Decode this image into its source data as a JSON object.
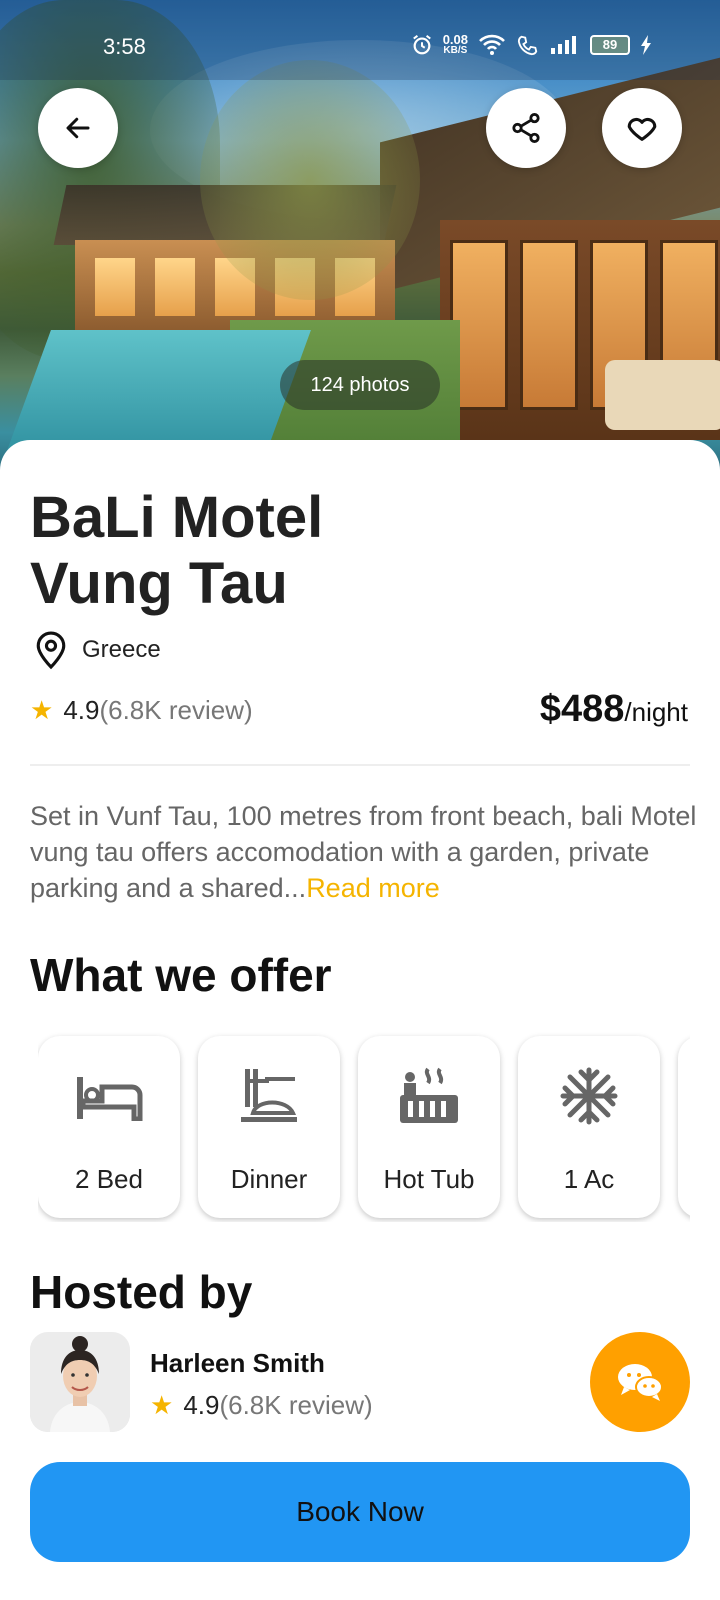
{
  "status_bar": {
    "time": "3:58",
    "speed_value": "0.08",
    "speed_unit": "KB/S",
    "battery": "89"
  },
  "hero": {
    "photos_label": "124 photos"
  },
  "listing": {
    "title_line1": "BaLi Motel",
    "title_line2": "Vung Tau",
    "location": "Greece",
    "rating": "4.9",
    "reviews": "(6.8K review)",
    "price": "$488",
    "price_unit": "/night",
    "description": "Set in Vunf Tau, 100 metres from front beach, bali Motel vung tau offers accomodation with a garden, private parking and a shared...",
    "read_more": "Read more"
  },
  "offers": {
    "heading": "What we offer",
    "items": [
      {
        "label": "2 Bed",
        "icon": "bed-icon"
      },
      {
        "label": "Dinner",
        "icon": "dinner-icon"
      },
      {
        "label": "Hot Tub",
        "icon": "hot-tub-icon"
      },
      {
        "label": "1 Ac",
        "icon": "snowflake-icon"
      }
    ]
  },
  "host": {
    "heading": "Hosted by",
    "name": "Harleen Smith",
    "rating": "4.9",
    "reviews": "(6.8K review)"
  },
  "cta": {
    "book_label": "Book Now"
  },
  "colors": {
    "accent_yellow": "#f5b400",
    "chat_orange": "#ffa000",
    "book_blue": "#2196f3"
  }
}
